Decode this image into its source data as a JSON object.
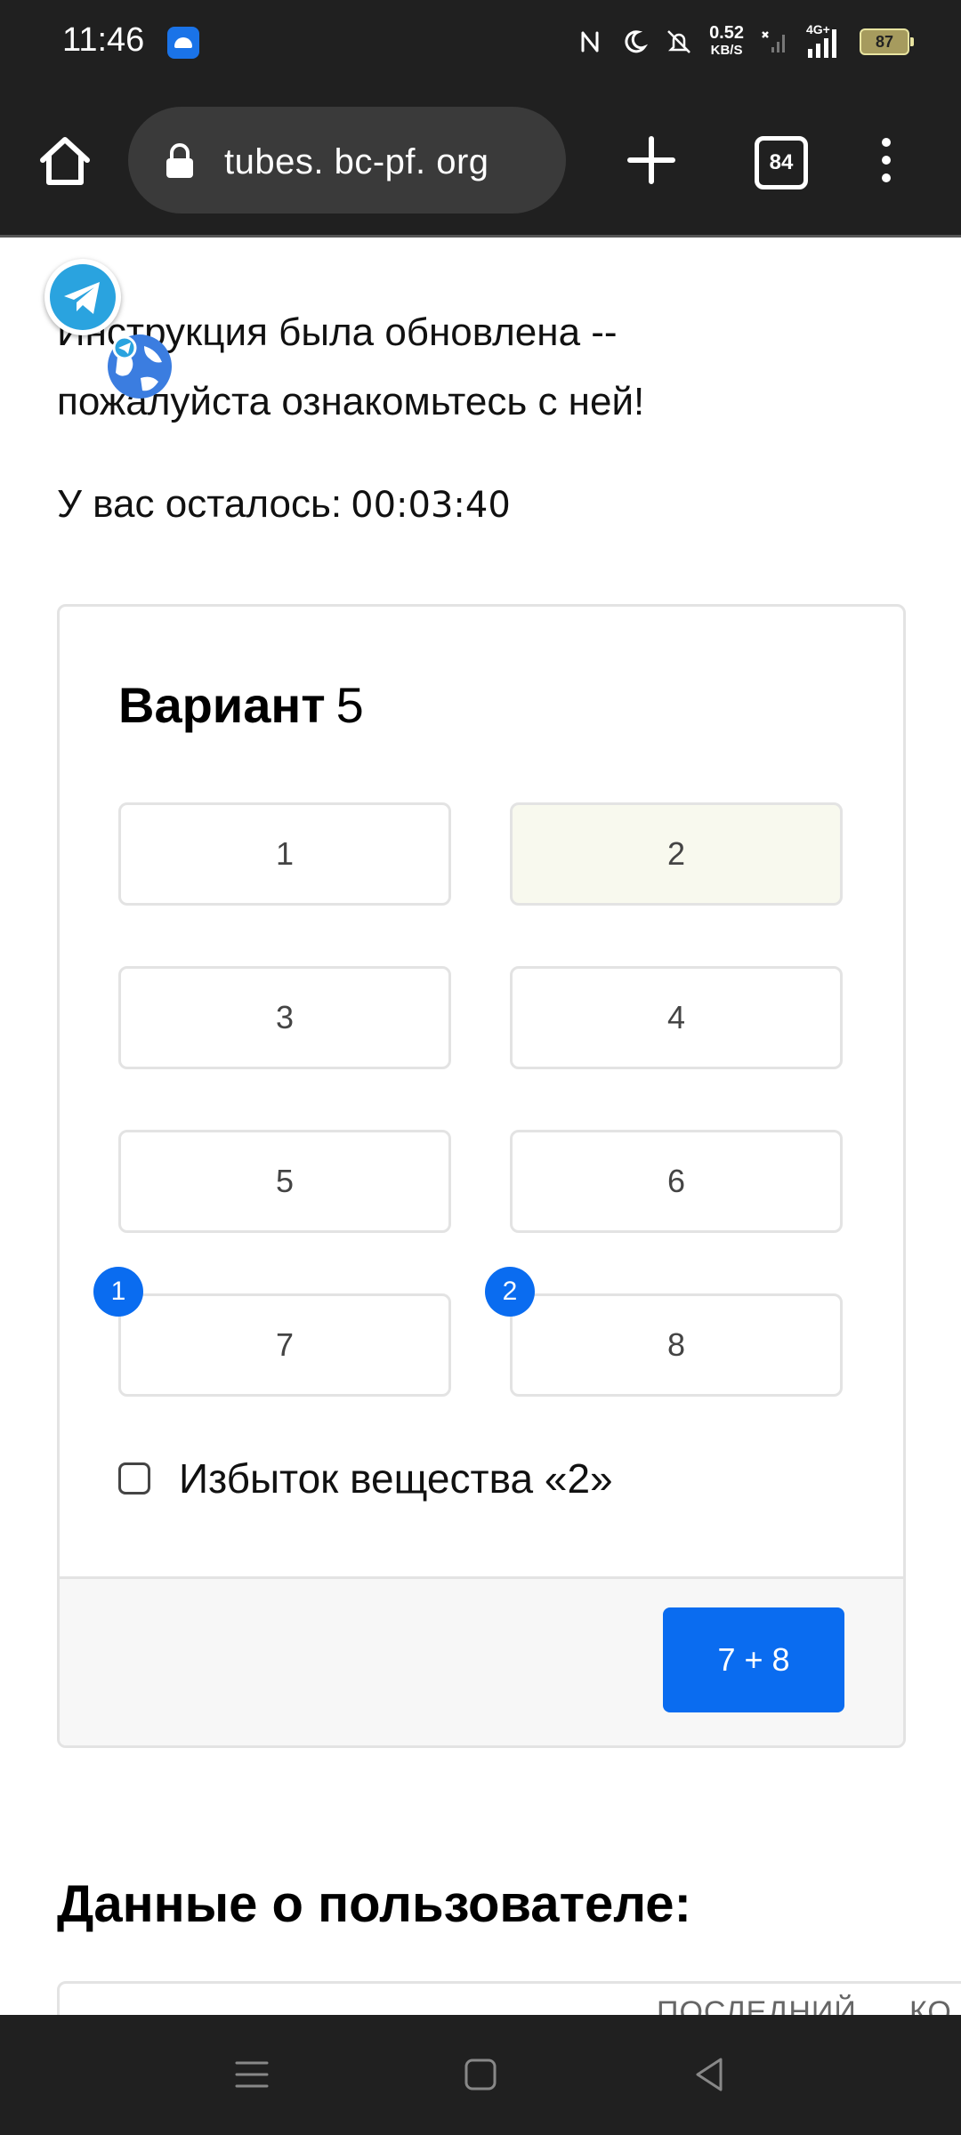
{
  "status_bar": {
    "time": "11:46",
    "net_speed_value": "0.52",
    "net_speed_unit": "KB/S",
    "network": "4G+",
    "battery": "87",
    "icons": [
      "notification-app-icon",
      "nfc-icon",
      "moon-icon",
      "vibrate-icon",
      "no-signal-icon",
      "signal-icon",
      "battery-icon"
    ]
  },
  "browser": {
    "url": "tubes. bc-pf. org",
    "tab_count": "84",
    "icons": [
      "home-icon",
      "lock-icon",
      "plus-icon",
      "tabs-icon",
      "menu-icon"
    ]
  },
  "page": {
    "notice": "Инструкция была обновлена -- пожалуйста ознакомьтесь с ней!",
    "timer_label": "У вас осталось:",
    "timer_value": "00:03:40",
    "variant_label": "Вариант",
    "variant_number": "5",
    "options": [
      {
        "label": "1",
        "selected": false
      },
      {
        "label": "2",
        "selected": true
      },
      {
        "label": "3",
        "selected": false
      },
      {
        "label": "4",
        "selected": false
      },
      {
        "label": "5",
        "selected": false
      },
      {
        "label": "6",
        "selected": false
      },
      {
        "label": "7",
        "selected": false,
        "badge": "1"
      },
      {
        "label": "8",
        "selected": false,
        "badge": "2"
      }
    ],
    "checkbox_label": "Избыток вещества «2»",
    "checkbox_checked": false,
    "submit_label": "7 + 8",
    "user_heading": "Данные о пользователе:",
    "table_headers": [
      "ПОСЛЕДНИЙ",
      "КО"
    ]
  },
  "colors": {
    "accent": "#0a6cf0",
    "selected_option_bg": "#f8f9ee",
    "chrome_bg": "#202020"
  }
}
